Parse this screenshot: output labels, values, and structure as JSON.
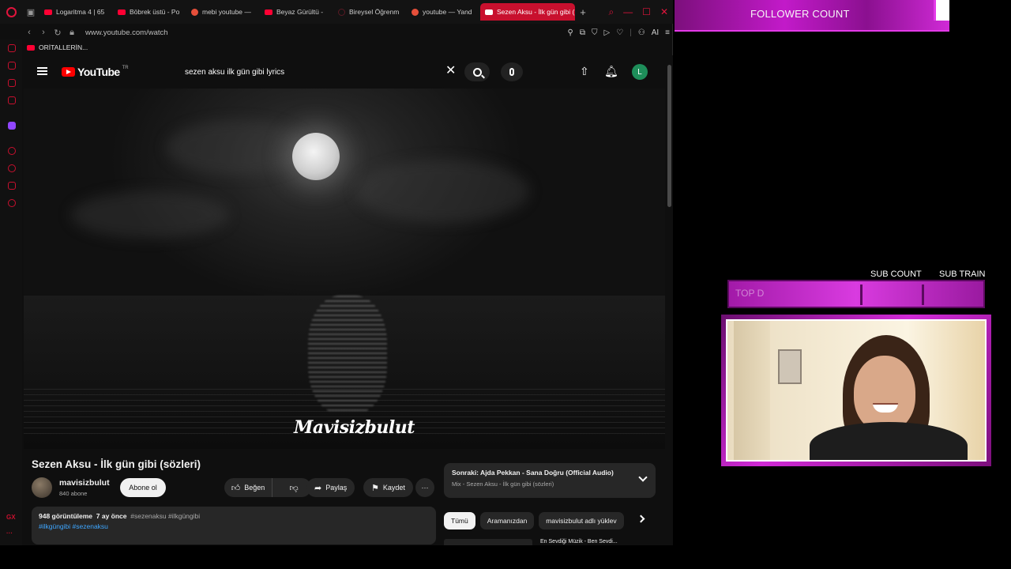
{
  "browser": {
    "tabs": [
      {
        "label": "Logaritma 4 | 65",
        "favicon": "youtube"
      },
      {
        "label": "Böbrek üstü - Po",
        "favicon": "youtube"
      },
      {
        "label": "mebi youtube —",
        "favicon": "yandex"
      },
      {
        "label": "Beyaz Gürültü - ",
        "favicon": "youtube"
      },
      {
        "label": "Bireysel Öğrenm",
        "favicon": "other"
      },
      {
        "label": "youtube — Yand",
        "favicon": "yandex"
      },
      {
        "label": "Sezen Aksu - İlk gün gibi (",
        "favicon": "youtube",
        "active": true
      }
    ],
    "url": "www.youtube.com/watch",
    "bookmark": "ORİTALLERİN...",
    "ai_label": "AI"
  },
  "youtube": {
    "logo_text": "YouTube",
    "country_code": "TR",
    "search_query": "sezen aksu ilk gün gibi lyrics",
    "avatar_letter": "L",
    "watermark": "Mavisizbulut",
    "video_title": "Sezen Aksu - İlk gün gibi (sözleri)",
    "channel_name": "mavisizbulut",
    "channel_subs": "840 abone",
    "subscribe_label": "Abone ol",
    "like_label": "Beğen",
    "share_label": "Paylaş",
    "save_label": "Kaydet",
    "views": "948 görüntüleme",
    "age": "7 ay önce",
    "desc_tags": "#sezenaksu #ilkgüngibi",
    "desc_links": "#ilkgüngibi #sezenaksu",
    "next_title": "Sonraki: Ajda Pekkan - Sana Doğru (Official Audio)",
    "next_sub": "Mix - Sezen Aksu - İlk gün gibi (sözleri)",
    "chips": [
      "Tümü",
      "Aramanızdan",
      "mavisizbulut adlı yüklev"
    ],
    "peek_text": "En Sevdiği Müzik - Ben Sevdi..."
  },
  "overlay": {
    "follower_count_label": "FOLLOWER COUNT",
    "sub_count_label": "SUB COUNT",
    "sub_train_label": "SUB TRAIN",
    "ghost_text": "TOP D",
    "accent": "#d02ad6"
  }
}
